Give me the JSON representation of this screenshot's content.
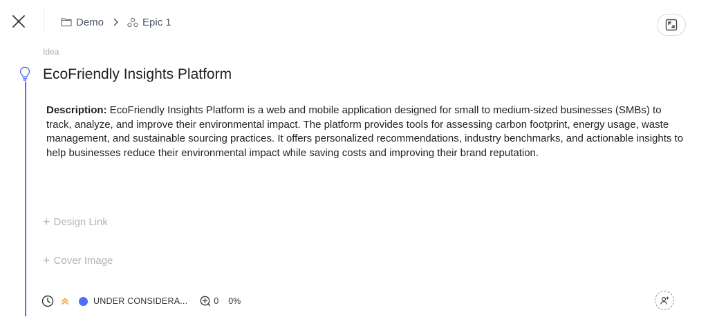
{
  "breadcrumb": {
    "items": [
      {
        "label": "Demo",
        "icon": "folder-icon"
      },
      {
        "label": "Epic 1",
        "icon": "epic-icon"
      }
    ]
  },
  "item": {
    "type_label": "Idea",
    "title": "EcoFriendly Insights Platform",
    "description_label": "Description:",
    "description_text": " EcoFriendly Insights Platform is a web and mobile application designed for small to medium-sized businesses (SMBs) to track, analyze, and improve their environmental impact. The platform provides tools for assessing carbon footprint, energy usage, waste management, and sustainable sourcing practices. It offers personalized recommendations, industry benchmarks, and actionable insights to help businesses reduce their environmental impact while saving costs and improving their brand reputation."
  },
  "actions": {
    "design_link": "Design Link",
    "cover_image": "Cover Image"
  },
  "footer": {
    "status": "UNDER CONSIDERA...",
    "votes": "0",
    "progress": "0%"
  },
  "colors": {
    "accent": "#4f6ef7",
    "priority": "#f0a020"
  }
}
